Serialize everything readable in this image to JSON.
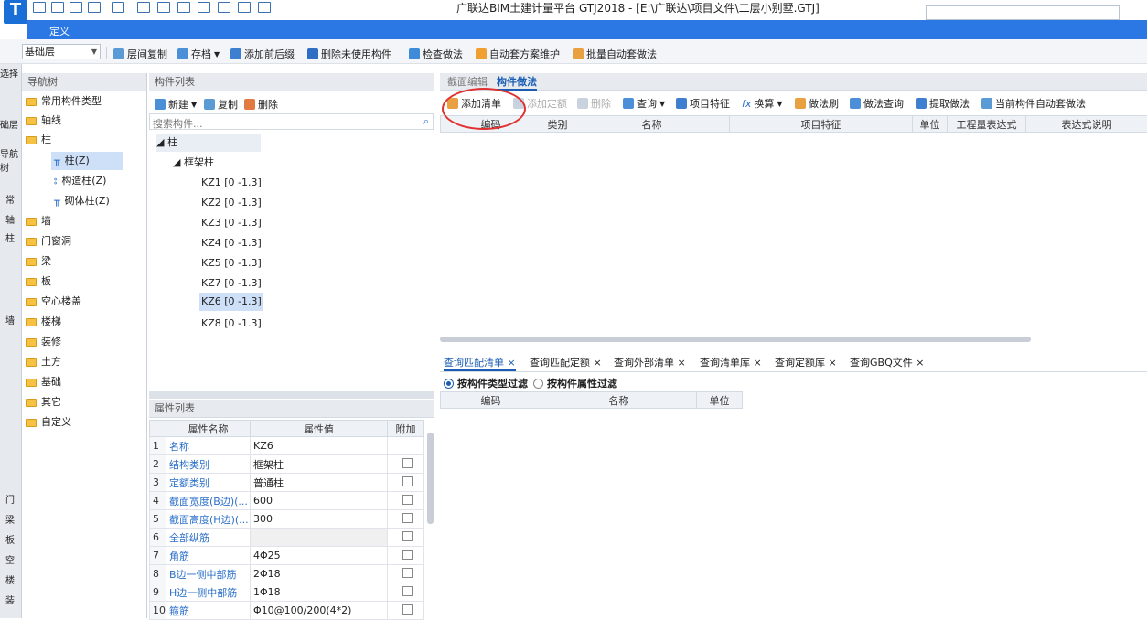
{
  "window": {
    "title": "广联达BIM土建计量平台 GTJ2018 - [E:\\广联达\\项目文件\\二层小别墅.GTJ]",
    "logo_text": "T"
  },
  "define_bar": {
    "label": "定义"
  },
  "toolbar": {
    "floor": "基础层",
    "items": [
      "层间复制",
      "存档",
      "添加前后缀",
      "删除未使用构件",
      "检查做法",
      "自动套方案维护",
      "批量自动套做法"
    ]
  },
  "left_strip": {
    "labels": [
      "选择",
      "础层",
      "导航树",
      "常",
      "轴",
      "柱",
      "墙",
      "门",
      "梁",
      "板",
      "空",
      "楼",
      "装"
    ]
  },
  "nav": {
    "header": "导航树",
    "items": [
      {
        "label": "常用构件类型",
        "type": "folder"
      },
      {
        "label": "轴线",
        "type": "folder"
      },
      {
        "label": "柱",
        "type": "folder"
      },
      {
        "label": "柱(Z)",
        "type": "child",
        "selected": true
      },
      {
        "label": "构造柱(Z)",
        "type": "child"
      },
      {
        "label": "砌体柱(Z)",
        "type": "child"
      },
      {
        "label": "墙",
        "type": "folder"
      },
      {
        "label": "门窗洞",
        "type": "folder"
      },
      {
        "label": "梁",
        "type": "folder"
      },
      {
        "label": "板",
        "type": "folder"
      },
      {
        "label": "空心楼盖",
        "type": "folder"
      },
      {
        "label": "楼梯",
        "type": "folder"
      },
      {
        "label": "装修",
        "type": "folder"
      },
      {
        "label": "土方",
        "type": "folder"
      },
      {
        "label": "基础",
        "type": "folder"
      },
      {
        "label": "其它",
        "type": "folder"
      },
      {
        "label": "自定义",
        "type": "folder"
      }
    ]
  },
  "components": {
    "header": "构件列表",
    "actions": {
      "new": "新建",
      "copy": "复制",
      "delete": "删除"
    },
    "search_placeholder": "搜索构件...",
    "tree_root": "柱",
    "tree_group": "框架柱",
    "items": [
      "KZ1 [0 -1.3]",
      "KZ2 [0 -1.3]",
      "KZ3 [0 -1.3]",
      "KZ4 [0 -1.3]",
      "KZ5 [0 -1.3]",
      "KZ7 [0 -1.3]",
      "KZ6 [0 -1.3]",
      "KZ8 [0 -1.3]"
    ],
    "selected_index": 6
  },
  "properties": {
    "header": "属性列表",
    "columns": [
      "属性名称",
      "属性值",
      "附加"
    ],
    "rows": [
      {
        "no": "1",
        "name": "名称",
        "value": "KZ6",
        "checkbox": false
      },
      {
        "no": "2",
        "name": "结构类别",
        "value": "框架柱",
        "checkbox": true
      },
      {
        "no": "3",
        "name": "定额类别",
        "value": "普通柱",
        "checkbox": true
      },
      {
        "no": "4",
        "name": "截面宽度(B边)(...",
        "value": "600",
        "checkbox": true
      },
      {
        "no": "5",
        "name": "截面高度(H边)(...",
        "value": "300",
        "checkbox": true
      },
      {
        "no": "6",
        "name": "全部纵筋",
        "value": "",
        "checkbox": true
      },
      {
        "no": "7",
        "name": "角筋",
        "value": "4Φ25",
        "checkbox": true
      },
      {
        "no": "8",
        "name": "B边一侧中部筋",
        "value": "2Φ18",
        "checkbox": true
      },
      {
        "no": "9",
        "name": "H边一侧中部筋",
        "value": "1Φ18",
        "checkbox": true
      },
      {
        "no": "10",
        "name": "箍筋",
        "value": "Φ10@100/200(4*2)",
        "checkbox": true
      }
    ]
  },
  "method": {
    "tabs": [
      "截面编辑",
      "构件做法"
    ],
    "active_tab": 1,
    "toolbar": [
      "添加清单",
      "添加定额",
      "删除",
      "查询",
      "项目特征",
      "换算",
      "做法刷",
      "做法查询",
      "提取做法",
      "当前构件自动套做法"
    ],
    "columns": [
      "编码",
      "类别",
      "名称",
      "项目特征",
      "单位",
      "工程量表达式",
      "表达式说明"
    ]
  },
  "query": {
    "tabs": [
      "查询匹配清单",
      "查询匹配定额",
      "查询外部清单",
      "查询清单库",
      "查询定额库",
      "查询GBQ文件"
    ],
    "filter_options": [
      "按构件类型过滤",
      "按构件属性过滤"
    ],
    "columns": [
      "编码",
      "名称",
      "单位"
    ]
  },
  "colors": {
    "accent": "#2b78e4",
    "highlight": "#e03030"
  }
}
